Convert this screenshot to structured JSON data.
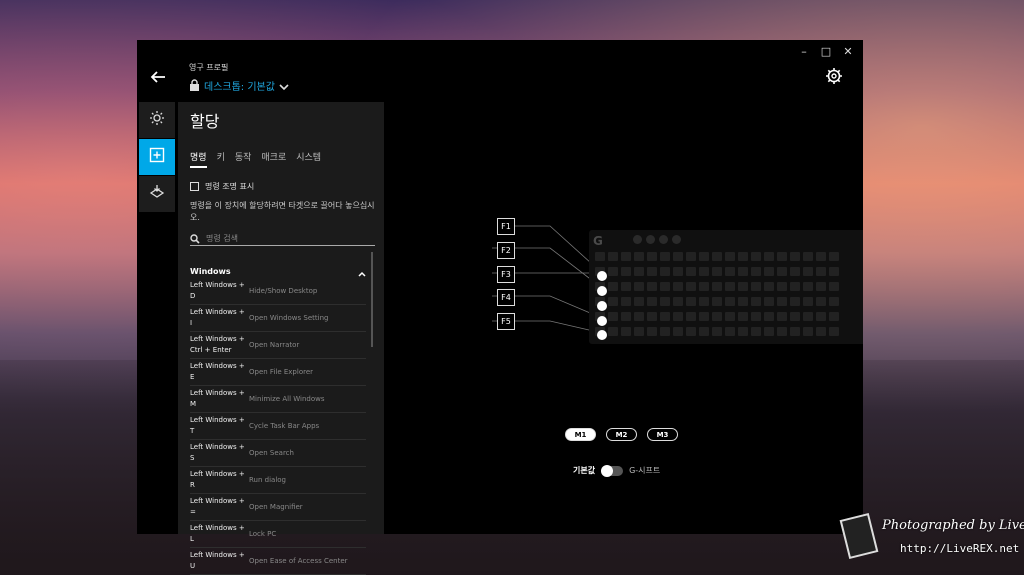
{
  "window": {
    "controls": {
      "minimize": "–",
      "maximize": "□",
      "close": "✕"
    }
  },
  "profile": {
    "label": "영구 프로필",
    "value": "데스크톱: 기본값"
  },
  "panel": {
    "title": "할당",
    "tabs": [
      "명령",
      "키",
      "동작",
      "매크로",
      "시스템"
    ],
    "active_tab": "명령",
    "show_lighting_label": "명령 조명 표시",
    "hint": "명령을 이 장치에 할당하려면 타겟으로 끌어다 놓으십시오.",
    "search_placeholder": "명령 검색",
    "group_title": "Windows",
    "commands": [
      {
        "keys": "Left Windows + D",
        "action": "Hide/Show Desktop"
      },
      {
        "keys": "Left Windows + I",
        "action": "Open Windows Setting"
      },
      {
        "keys": "Left Windows + Ctrl + Enter",
        "action": "Open Narrator"
      },
      {
        "keys": "Left Windows + E",
        "action": "Open File Explorer"
      },
      {
        "keys": "Left Windows + M",
        "action": "Minimize All Windows"
      },
      {
        "keys": "Left Windows + T",
        "action": "Cycle Task Bar Apps"
      },
      {
        "keys": "Left Windows + S",
        "action": "Open Search"
      },
      {
        "keys": "Left Windows + R",
        "action": "Run dialog"
      },
      {
        "keys": "Left Windows + =",
        "action": "Open Magnifier"
      },
      {
        "keys": "Left Windows + L",
        "action": "Lock PC"
      },
      {
        "keys": "Left Windows + U",
        "action": "Open Ease of Access Center"
      }
    ]
  },
  "keyboard": {
    "fkeys": [
      "F1",
      "F2",
      "F3",
      "F4",
      "F5"
    ],
    "logo": "G"
  },
  "modes": {
    "items": [
      "M1",
      "M2",
      "M3"
    ],
    "active": "M1"
  },
  "gshift": {
    "default_label": "기본값",
    "shift_label": "G-시프트",
    "enabled": false
  },
  "watermark": {
    "line1": "Photographed by LiveREX",
    "line2": "http://LiveREX.net"
  },
  "colors": {
    "accent": "#00a8e8",
    "profile_text": "#20a8e0",
    "panel_bg": "#1b1b1b",
    "window_bg": "#000000"
  }
}
